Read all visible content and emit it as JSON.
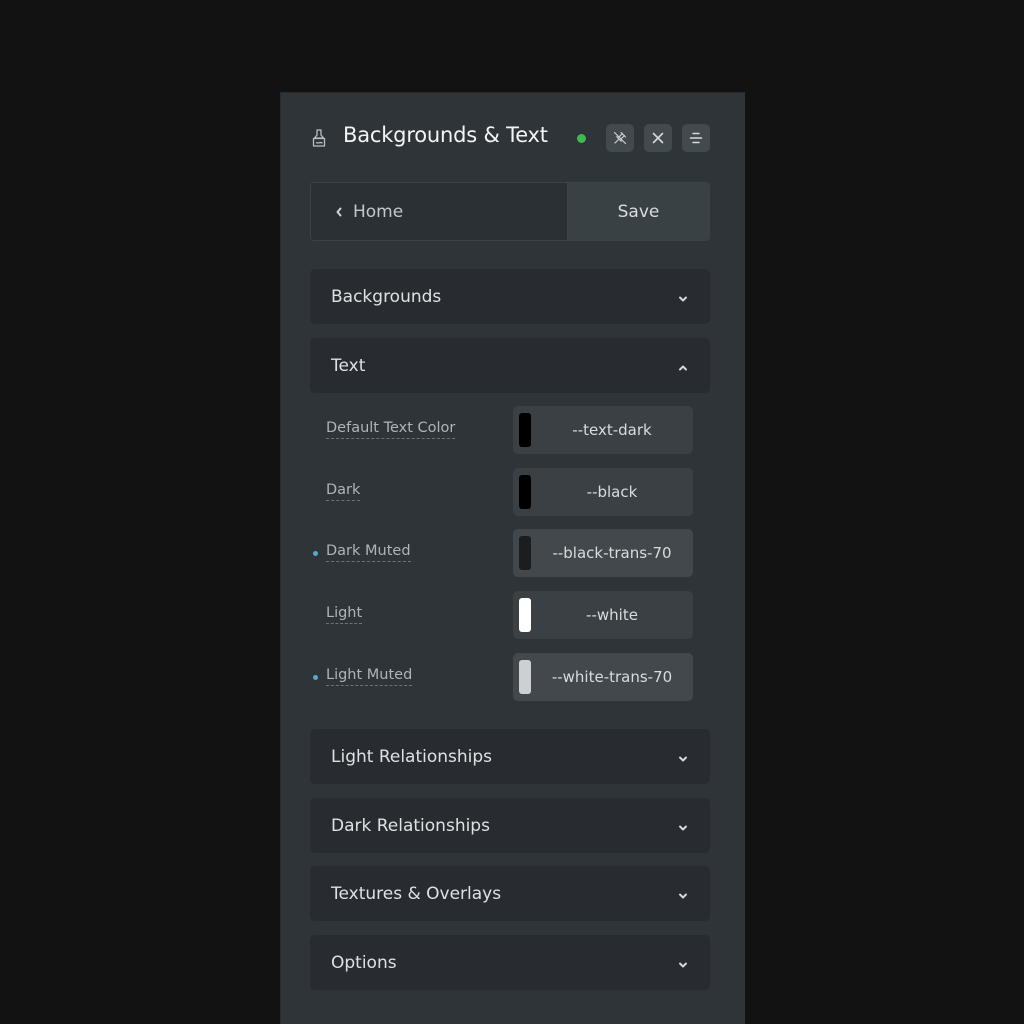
{
  "header": {
    "title": "Backgrounds & Text",
    "icon": "paintbrush-icon",
    "status_color": "#3fb950",
    "buttons": [
      {
        "name": "unpin",
        "icon": "unpin-icon"
      },
      {
        "name": "close",
        "icon": "close-icon"
      },
      {
        "name": "menu",
        "icon": "menu-icon"
      }
    ]
  },
  "nav": {
    "back_label": "Home",
    "save_label": "Save"
  },
  "sections": {
    "backgrounds": {
      "label": "Backgrounds",
      "expanded": false
    },
    "text": {
      "label": "Text",
      "expanded": true
    },
    "light_relationships": {
      "label": "Light Relationships",
      "expanded": false
    },
    "dark_relationships": {
      "label": "Dark Relationships",
      "expanded": false
    },
    "textures": {
      "label": "Textures & Overlays",
      "expanded": false
    },
    "options": {
      "label": "Options",
      "expanded": false
    }
  },
  "text_rows": [
    {
      "label": "Default Text Color",
      "value": "--text-dark",
      "swatch": "#000000",
      "modified": false
    },
    {
      "label": "Dark",
      "value": "--black",
      "swatch": "#000000",
      "modified": false
    },
    {
      "label": "Dark Muted",
      "value": "--black-trans-70",
      "swatch": "#1b1d1f",
      "modified": true
    },
    {
      "label": "Light",
      "value": "--white",
      "swatch": "#ffffff",
      "modified": false
    },
    {
      "label": "Light Muted",
      "value": "--white-trans-70",
      "swatch": "#cdd0d2",
      "modified": true
    }
  ],
  "colors": {
    "modified_dot": "#5ba6cf"
  }
}
